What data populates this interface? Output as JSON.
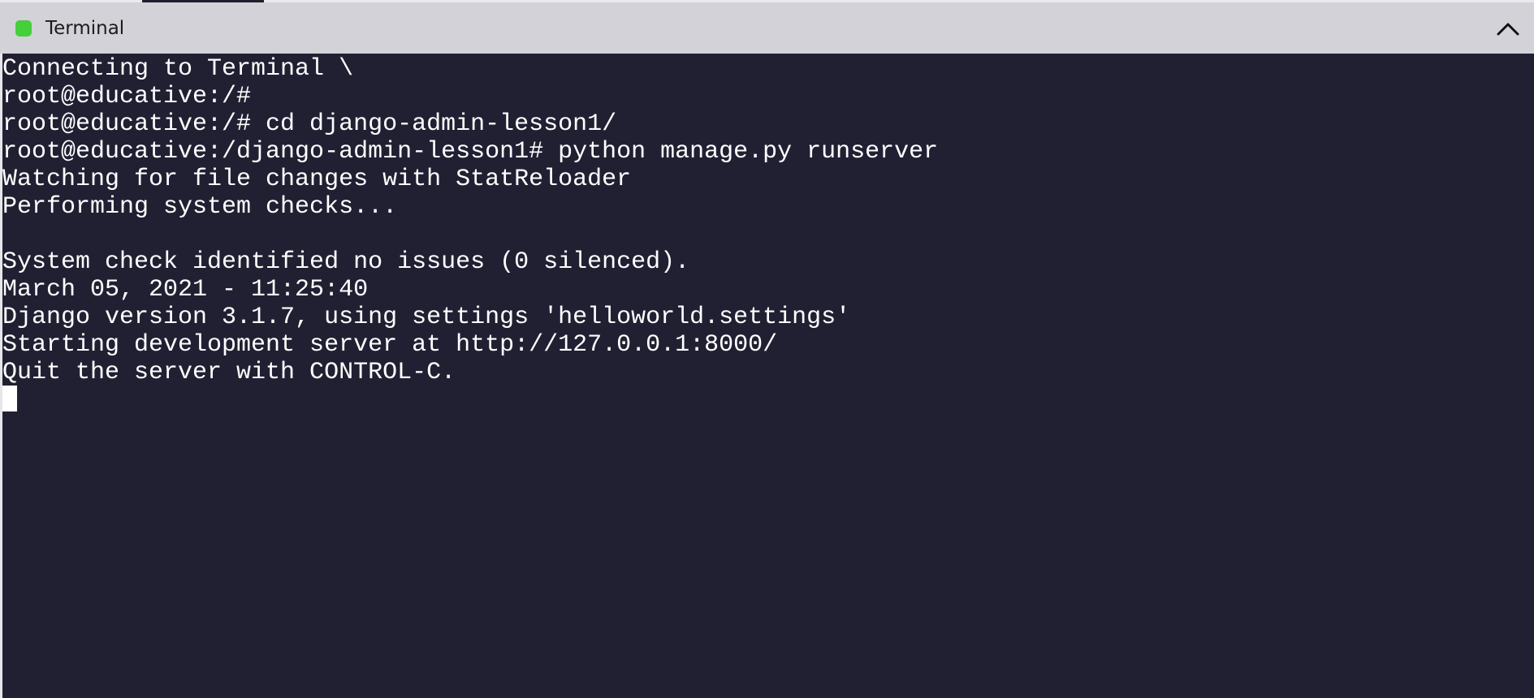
{
  "window": {
    "title": "Terminal",
    "status_color": "#45cf3a",
    "collapse_icon": "chevron-up-icon"
  },
  "terminal": {
    "lines": [
      "Connecting to Terminal \\",
      "root@educative:/#",
      "root@educative:/# cd django-admin-lesson1/",
      "root@educative:/django-admin-lesson1# python manage.py runserver",
      "Watching for file changes with StatReloader",
      "Performing system checks...",
      "",
      "System check identified no issues (0 silenced).",
      "March 05, 2021 - 11:25:40",
      "Django version 3.1.7, using settings 'helloworld.settings'",
      "Starting development server at http://127.0.0.1:8000/",
      "Quit the server with CONTROL-C."
    ],
    "background_color": "#212033",
    "text_color": "#ffffff"
  }
}
